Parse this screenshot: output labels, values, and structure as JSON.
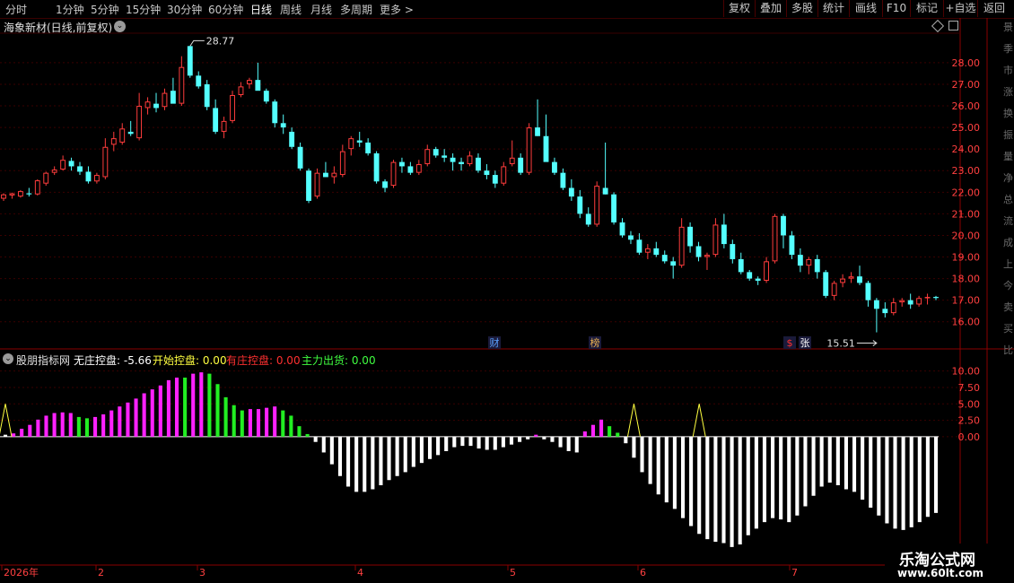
{
  "toolbar": {
    "periods": [
      "分时",
      "1分钟",
      "5分钟",
      "15分钟",
      "30分钟",
      "60分钟",
      "日线",
      "周线",
      "月线",
      "多周期",
      "更多"
    ],
    "active_period": "日线",
    "more_arrow": ">",
    "right_buttons": [
      "复权",
      "叠加",
      "多股",
      "统计",
      "画线",
      "F10",
      "标记",
      "+自选",
      "返回"
    ]
  },
  "stock": {
    "title": "海象新材(日线,前复权)",
    "menu_icon": "chevron-down-icon",
    "max_label": "28.77",
    "min_label": "15.51",
    "price_axis": [
      "28.00",
      "27.00",
      "26.00",
      "25.00",
      "24.00",
      "23.00",
      "22.00",
      "21.00",
      "20.00",
      "19.00",
      "18.00",
      "17.00",
      "16.00"
    ],
    "event_markers": [
      {
        "text": "财",
        "color": "#5aa0ff"
      },
      {
        "text": "榜",
        "color": "#e8b050"
      },
      {
        "text": "$",
        "color": "#ff3030"
      },
      {
        "text": "张",
        "color": "#ffffff"
      }
    ]
  },
  "indicator": {
    "name": "股朋指标网",
    "items": [
      {
        "label": "无庄控盘: -5.66",
        "color": "#ffffff"
      },
      {
        "label": "开始控盘: 0.00",
        "color": "#ffff40"
      },
      {
        "label": "有庄控盘: 0.00",
        "color": "#ff3030"
      },
      {
        "label": "主力出货: 0.00",
        "color": "#40ff40"
      }
    ],
    "axis": [
      "10.00",
      "7.50",
      "5.00",
      "2.50",
      "0.00"
    ]
  },
  "date_axis": [
    "2026年",
    "2",
    "3",
    "4",
    "5",
    "6",
    "7"
  ],
  "watermark": {
    "line1": "乐淘公式网",
    "line2": "www.60lt.com"
  },
  "right_edge_labels": [
    "景",
    "季",
    "市",
    "涨",
    "换",
    "振",
    "量",
    "净",
    "总",
    "流",
    "成",
    "上",
    "今",
    "卖",
    "买",
    "比"
  ],
  "colors": {
    "up": "#ff3c3c",
    "down": "#54ffff",
    "magenta": "#ff22ff",
    "green": "#22ee22",
    "white": "#ffffff",
    "yellow": "#ffff40",
    "grid": "#3a0000",
    "border": "#8a0000",
    "axis_text": "#ff4040"
  },
  "chart_data": {
    "type": "candlestick",
    "price_range": [
      15.2,
      29.2
    ],
    "days": 69,
    "ohlc": [
      [
        21.7,
        21.95,
        21.6,
        21.9
      ],
      [
        21.85,
        21.98,
        21.7,
        21.95
      ],
      [
        21.8,
        22.1,
        21.75,
        22.05
      ],
      [
        21.95,
        22.2,
        21.8,
        21.9
      ],
      [
        21.9,
        22.6,
        21.85,
        22.55
      ],
      [
        22.4,
        22.95,
        22.3,
        22.9
      ],
      [
        22.9,
        23.2,
        22.8,
        23.05
      ],
      [
        23.05,
        23.7,
        23.0,
        23.5
      ],
      [
        23.45,
        23.6,
        23.0,
        23.2
      ],
      [
        23.2,
        23.4,
        22.8,
        22.95
      ],
      [
        22.95,
        23.2,
        22.4,
        22.5
      ],
      [
        22.5,
        22.9,
        22.4,
        22.8
      ],
      [
        22.7,
        24.5,
        22.6,
        24.1
      ],
      [
        24.2,
        24.8,
        23.9,
        24.5
      ],
      [
        24.3,
        25.2,
        24.2,
        24.95
      ],
      [
        24.8,
        25.3,
        24.6,
        24.7
      ],
      [
        24.5,
        26.6,
        24.4,
        26.0
      ],
      [
        25.9,
        26.4,
        25.6,
        26.2
      ],
      [
        26.1,
        26.6,
        25.7,
        25.9
      ],
      [
        25.95,
        26.8,
        25.8,
        26.6
      ],
      [
        26.7,
        27.3,
        26.6,
        26.1
      ],
      [
        26.1,
        28.3,
        26.0,
        27.8
      ],
      [
        28.77,
        28.77,
        27.3,
        27.4
      ],
      [
        27.4,
        27.6,
        26.8,
        26.9
      ],
      [
        27.0,
        27.2,
        25.8,
        25.95
      ],
      [
        25.9,
        26.3,
        24.7,
        24.8
      ],
      [
        24.8,
        25.5,
        24.5,
        25.3
      ],
      [
        25.3,
        26.7,
        25.2,
        26.5
      ],
      [
        26.5,
        27.1,
        26.4,
        26.9
      ],
      [
        27.0,
        27.3,
        26.8,
        27.2
      ],
      [
        27.2,
        28.0,
        26.9,
        26.7
      ],
      [
        26.7,
        26.8,
        26.1,
        26.2
      ],
      [
        26.2,
        26.3,
        25.0,
        25.2
      ],
      [
        25.2,
        25.6,
        24.7,
        25.0
      ],
      [
        24.8,
        25.0,
        24.0,
        24.1
      ],
      [
        24.1,
        24.3,
        23.0,
        23.1
      ],
      [
        23.0,
        23.1,
        21.5,
        21.6
      ],
      [
        21.8,
        23.1,
        21.7,
        22.9
      ],
      [
        22.9,
        23.4,
        22.7,
        22.7
      ],
      [
        22.7,
        23.2,
        22.4,
        22.9
      ],
      [
        22.8,
        24.2,
        22.7,
        23.9
      ],
      [
        24.0,
        24.6,
        23.7,
        24.5
      ],
      [
        24.4,
        24.8,
        24.1,
        24.3
      ],
      [
        24.3,
        24.5,
        23.7,
        23.8
      ],
      [
        23.8,
        23.9,
        22.4,
        22.5
      ],
      [
        22.5,
        22.6,
        22.0,
        22.2
      ],
      [
        22.3,
        23.5,
        22.2,
        23.4
      ],
      [
        23.4,
        23.6,
        22.9,
        23.2
      ],
      [
        23.2,
        23.4,
        22.8,
        22.9
      ],
      [
        22.9,
        23.5,
        22.8,
        23.3
      ],
      [
        23.3,
        24.2,
        23.2,
        24.0
      ],
      [
        24.0,
        24.1,
        23.6,
        23.7
      ],
      [
        23.7,
        24.0,
        23.4,
        23.6
      ],
      [
        23.6,
        23.8,
        23.0,
        23.4
      ],
      [
        23.4,
        23.6,
        23.0,
        23.3
      ],
      [
        23.3,
        23.9,
        23.2,
        23.7
      ],
      [
        23.6,
        23.8,
        22.9,
        23.0
      ],
      [
        23.0,
        23.3,
        22.6,
        22.8
      ],
      [
        22.8,
        23.0,
        22.2,
        22.4
      ],
      [
        22.4,
        23.4,
        22.3,
        23.2
      ],
      [
        23.3,
        24.4,
        23.2,
        23.6
      ],
      [
        23.6,
        23.8,
        22.8,
        22.9
      ],
      [
        22.9,
        25.2,
        22.8,
        25.0
      ],
      [
        25.0,
        26.3,
        24.6,
        24.6
      ],
      [
        24.6,
        25.6,
        23.5,
        23.4
      ],
      [
        23.4,
        23.6,
        22.8,
        22.9
      ],
      [
        22.9,
        23.1,
        22.1,
        22.2
      ],
      [
        22.2,
        22.6,
        21.6,
        21.8
      ],
      [
        21.8,
        22.1,
        20.8,
        21.0
      ],
      [
        21.0,
        21.3,
        20.4,
        20.5
      ],
      [
        20.5,
        22.5,
        20.4,
        22.3
      ],
      [
        22.2,
        24.3,
        21.9,
        21.9
      ],
      [
        21.9,
        22.0,
        20.5,
        20.6
      ],
      [
        20.6,
        20.8,
        19.9,
        20.0
      ],
      [
        20.0,
        20.2,
        19.6,
        19.8
      ],
      [
        19.8,
        20.1,
        19.1,
        19.2
      ],
      [
        19.2,
        19.6,
        18.9,
        19.4
      ],
      [
        19.4,
        19.7,
        19.0,
        19.1
      ],
      [
        19.1,
        19.3,
        18.7,
        18.8
      ],
      [
        18.8,
        19.0,
        18.0,
        18.6
      ],
      [
        18.6,
        20.8,
        18.5,
        20.4
      ],
      [
        20.4,
        20.6,
        19.2,
        19.5
      ],
      [
        19.5,
        19.7,
        18.8,
        19.0
      ],
      [
        19.0,
        19.2,
        18.4,
        19.1
      ],
      [
        19.1,
        20.8,
        19.0,
        20.5
      ],
      [
        20.5,
        21.0,
        19.4,
        19.6
      ],
      [
        19.6,
        19.8,
        18.7,
        18.9
      ],
      [
        18.9,
        19.2,
        18.2,
        18.3
      ],
      [
        18.3,
        18.4,
        17.9,
        18.0
      ],
      [
        18.0,
        18.1,
        17.7,
        17.9
      ],
      [
        17.9,
        19.0,
        17.8,
        18.8
      ],
      [
        18.8,
        21.0,
        18.7,
        20.9
      ],
      [
        20.9,
        21.0,
        19.4,
        20.0
      ],
      [
        20.0,
        20.2,
        18.9,
        19.1
      ],
      [
        19.1,
        19.4,
        18.3,
        18.6
      ],
      [
        18.6,
        19.0,
        18.2,
        18.9
      ],
      [
        18.9,
        19.1,
        18.0,
        18.3
      ],
      [
        18.3,
        18.4,
        17.1,
        17.2
      ],
      [
        17.2,
        17.9,
        17.0,
        17.8
      ],
      [
        17.8,
        18.2,
        17.6,
        18.0
      ],
      [
        18.0,
        18.3,
        17.8,
        18.1
      ],
      [
        18.1,
        18.6,
        17.7,
        17.8
      ],
      [
        17.8,
        17.9,
        16.7,
        17.0
      ],
      [
        17.0,
        17.1,
        15.51,
        16.6
      ],
      [
        16.6,
        16.9,
        16.2,
        16.4
      ],
      [
        16.4,
        17.1,
        16.3,
        16.9
      ],
      [
        16.9,
        17.1,
        16.7,
        17.0
      ],
      [
        17.0,
        17.3,
        16.6,
        16.8
      ],
      [
        16.8,
        17.2,
        16.7,
        17.1
      ],
      [
        17.1,
        17.3,
        16.8,
        17.15
      ],
      [
        17.15,
        17.2,
        17.0,
        17.1
      ]
    ],
    "indicator_range": [
      -19,
      12
    ],
    "indicator_bars": [
      {
        "v": 0.3,
        "c": "white"
      },
      {
        "v": 0.5,
        "c": "magenta"
      },
      {
        "v": 1.2,
        "c": "magenta"
      },
      {
        "v": 1.8,
        "c": "magenta"
      },
      {
        "v": 2.6,
        "c": "magenta"
      },
      {
        "v": 3.2,
        "c": "magenta"
      },
      {
        "v": 3.6,
        "c": "magenta"
      },
      {
        "v": 3.7,
        "c": "magenta"
      },
      {
        "v": 3.6,
        "c": "magenta"
      },
      {
        "v": 3.0,
        "c": "green"
      },
      {
        "v": 2.8,
        "c": "green"
      },
      {
        "v": 3.0,
        "c": "magenta"
      },
      {
        "v": 3.4,
        "c": "magenta"
      },
      {
        "v": 4.0,
        "c": "magenta"
      },
      {
        "v": 4.6,
        "c": "magenta"
      },
      {
        "v": 5.2,
        "c": "magenta"
      },
      {
        "v": 5.8,
        "c": "magenta"
      },
      {
        "v": 6.6,
        "c": "magenta"
      },
      {
        "v": 7.2,
        "c": "magenta"
      },
      {
        "v": 7.8,
        "c": "magenta"
      },
      {
        "v": 8.6,
        "c": "magenta"
      },
      {
        "v": 9.0,
        "c": "magenta"
      },
      {
        "v": 9.0,
        "c": "green"
      },
      {
        "v": 9.6,
        "c": "magenta"
      },
      {
        "v": 9.8,
        "c": "magenta"
      },
      {
        "v": 9.6,
        "c": "green"
      },
      {
        "v": 8.0,
        "c": "green"
      },
      {
        "v": 6.0,
        "c": "green"
      },
      {
        "v": 4.8,
        "c": "green"
      },
      {
        "v": 4.0,
        "c": "green"
      },
      {
        "v": 4.2,
        "c": "magenta"
      },
      {
        "v": 4.2,
        "c": "magenta"
      },
      {
        "v": 4.4,
        "c": "magenta"
      },
      {
        "v": 4.6,
        "c": "magenta"
      },
      {
        "v": 4.0,
        "c": "green"
      },
      {
        "v": 3.2,
        "c": "green"
      },
      {
        "v": 1.6,
        "c": "green"
      },
      {
        "v": 0.4,
        "c": "green"
      },
      {
        "v": -0.8,
        "c": "white"
      },
      {
        "v": -2.4,
        "c": "white"
      },
      {
        "v": -4.2,
        "c": "white"
      },
      {
        "v": -6.0,
        "c": "white"
      },
      {
        "v": -7.6,
        "c": "white"
      },
      {
        "v": -8.4,
        "c": "white"
      },
      {
        "v": -8.4,
        "c": "white"
      },
      {
        "v": -8.0,
        "c": "white"
      },
      {
        "v": -7.4,
        "c": "white"
      },
      {
        "v": -6.6,
        "c": "white"
      },
      {
        "v": -6.0,
        "c": "white"
      },
      {
        "v": -5.4,
        "c": "white"
      },
      {
        "v": -4.6,
        "c": "white"
      },
      {
        "v": -4.0,
        "c": "white"
      },
      {
        "v": -3.4,
        "c": "white"
      },
      {
        "v": -2.8,
        "c": "white"
      },
      {
        "v": -2.2,
        "c": "white"
      },
      {
        "v": -1.6,
        "c": "white"
      },
      {
        "v": -1.4,
        "c": "white"
      },
      {
        "v": -1.4,
        "c": "white"
      },
      {
        "v": -1.8,
        "c": "white"
      },
      {
        "v": -2.0,
        "c": "white"
      },
      {
        "v": -2.0,
        "c": "white"
      },
      {
        "v": -1.6,
        "c": "white"
      },
      {
        "v": -1.2,
        "c": "white"
      },
      {
        "v": -0.8,
        "c": "white"
      },
      {
        "v": -0.4,
        "c": "white"
      },
      {
        "v": 0.3,
        "c": "magenta"
      },
      {
        "v": -0.4,
        "c": "white"
      },
      {
        "v": -0.8,
        "c": "white"
      },
      {
        "v": -1.6,
        "c": "white"
      },
      {
        "v": -2.2,
        "c": "white"
      },
      {
        "v": -2.4,
        "c": "white"
      },
      {
        "v": 0.8,
        "c": "magenta"
      },
      {
        "v": 1.8,
        "c": "magenta"
      },
      {
        "v": 2.6,
        "c": "magenta"
      },
      {
        "v": 1.6,
        "c": "green"
      },
      {
        "v": 0.6,
        "c": "green"
      },
      {
        "v": -1.0,
        "c": "white"
      },
      {
        "v": -3.2,
        "c": "white"
      },
      {
        "v": -5.4,
        "c": "white"
      },
      {
        "v": -7.2,
        "c": "white"
      },
      {
        "v": -8.8,
        "c": "white"
      },
      {
        "v": -10.0,
        "c": "white"
      },
      {
        "v": -11.0,
        "c": "white"
      },
      {
        "v": -12.4,
        "c": "white"
      },
      {
        "v": -13.6,
        "c": "white"
      },
      {
        "v": -14.8,
        "c": "white"
      },
      {
        "v": -15.6,
        "c": "white"
      },
      {
        "v": -16.0,
        "c": "white"
      },
      {
        "v": -16.2,
        "c": "white"
      },
      {
        "v": -16.8,
        "c": "white"
      },
      {
        "v": -16.4,
        "c": "white"
      },
      {
        "v": -15.0,
        "c": "white"
      },
      {
        "v": -14.0,
        "c": "white"
      },
      {
        "v": -13.0,
        "c": "white"
      },
      {
        "v": -12.4,
        "c": "white"
      },
      {
        "v": -12.6,
        "c": "white"
      },
      {
        "v": -13.0,
        "c": "white"
      },
      {
        "v": -12.0,
        "c": "white"
      },
      {
        "v": -10.6,
        "c": "white"
      },
      {
        "v": -9.0,
        "c": "white"
      },
      {
        "v": -7.6,
        "c": "white"
      },
      {
        "v": -7.0,
        "c": "white"
      },
      {
        "v": -7.4,
        "c": "white"
      },
      {
        "v": -8.0,
        "c": "white"
      },
      {
        "v": -8.4,
        "c": "white"
      },
      {
        "v": -9.6,
        "c": "white"
      },
      {
        "v": -10.8,
        "c": "white"
      },
      {
        "v": -12.0,
        "c": "white"
      },
      {
        "v": -13.2,
        "c": "white"
      },
      {
        "v": -14.0,
        "c": "white"
      },
      {
        "v": -14.2,
        "c": "white"
      },
      {
        "v": -13.8,
        "c": "white"
      },
      {
        "v": -13.0,
        "c": "white"
      },
      {
        "v": -12.2,
        "c": "white"
      },
      {
        "v": -11.6,
        "c": "white"
      }
    ],
    "spikes": [
      {
        "bar": 0,
        "value": 5.0
      },
      {
        "bar": 77,
        "value": 5.0
      },
      {
        "bar": 85,
        "value": 5.0
      }
    ]
  }
}
